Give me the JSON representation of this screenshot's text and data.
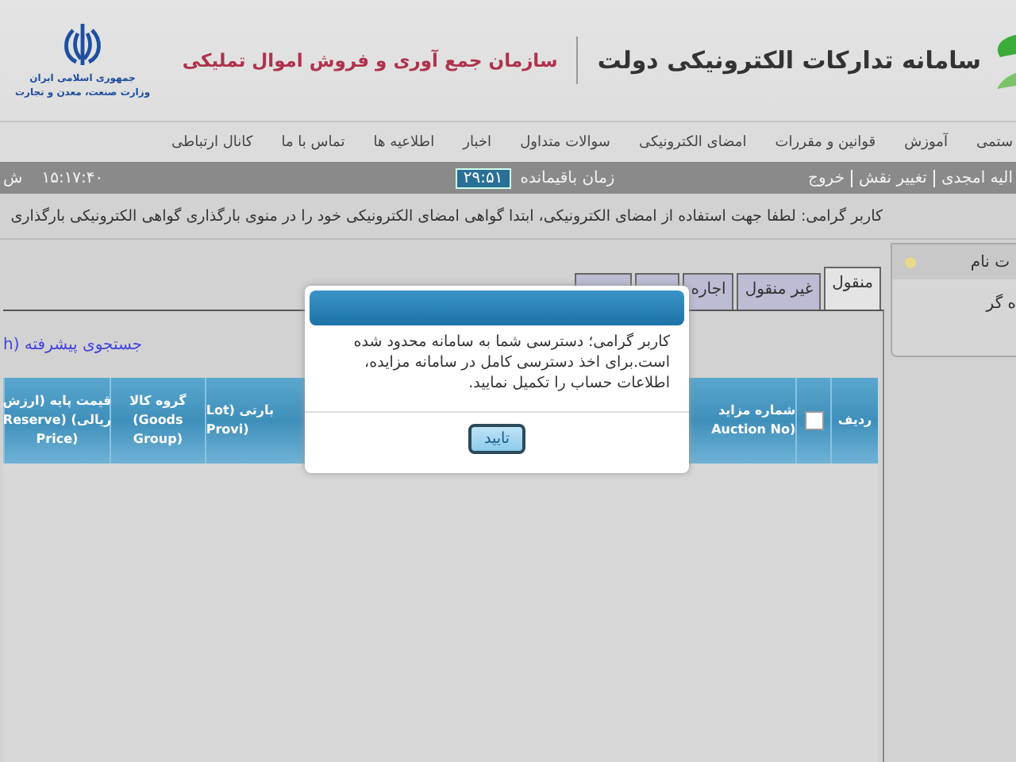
{
  "header": {
    "title": "سامانه تداركات الكترونيكی دولت",
    "subtitle": "سازمان جمع آوری و فروش اموال تمليكی",
    "emblem_lines": [
      "جمهوری اسلامی ایران",
      "وزارت صنعت، معدن و تجارت"
    ]
  },
  "nav": [
    "ستمی",
    "آموزش",
    "قوانين و مقررات",
    "امضای الکترونیکی",
    "سوالات متداول",
    "اخبار",
    "اطلاعیه ها",
    "تماس با ما",
    "کانال ارتباطی"
  ],
  "user_bar": {
    "links": [
      "اليه امجدی",
      "تغيير نقش",
      "خروج"
    ],
    "timer_label": "زمان باقيمانده",
    "timer": "۲۹:۵۱",
    "clock": "۱۵:۱۷:۴۰",
    "date": "ش"
  },
  "notice": "کاربر گرامی: لطفا جهت استفاده از امضای الکترونیکی، ابتدا گواهی امضای الکترونیکی خود را در منوی بارگذاری گواهی الکترونیکی بارگذاری",
  "side_panel": {
    "title": "ت نام",
    "item": "ه گر"
  },
  "tabs": [
    {
      "label": "منقول",
      "selected": true
    },
    {
      "label": "غير منقول",
      "selected": false
    },
    {
      "label": "اجاره",
      "selected": false
    }
  ],
  "advanced_search": "جستجوی پیشرفته (h",
  "table": {
    "columns": [
      {
        "kind": "text",
        "lines": [
          "ردیف"
        ]
      },
      {
        "kind": "checkbox",
        "checked": false
      },
      {
        "kind": "text",
        "lines": [
          "شماره مزاید",
          "(Auction No"
        ]
      },
      {
        "kind": "blank"
      },
      {
        "kind": "text",
        "lines": [
          "بارتی (Lot",
          "(Provi"
        ]
      },
      {
        "kind": "text",
        "lines": [
          "گروه کالا",
          "Goods)",
          "(Group"
        ]
      },
      {
        "kind": "text",
        "lines": [
          "قیمت پایه (ارزش",
          "ریالی) (Reserve",
          "(Price"
        ]
      }
    ]
  },
  "dialog": {
    "message": "کاربر گرامی؛ دسترسی شما به سامانه محدود شده است.برای اخذ دسترسی کامل در سامانه مزایده، اطلاعات حساب را تکمیل نمایید.",
    "button": "تایید"
  }
}
